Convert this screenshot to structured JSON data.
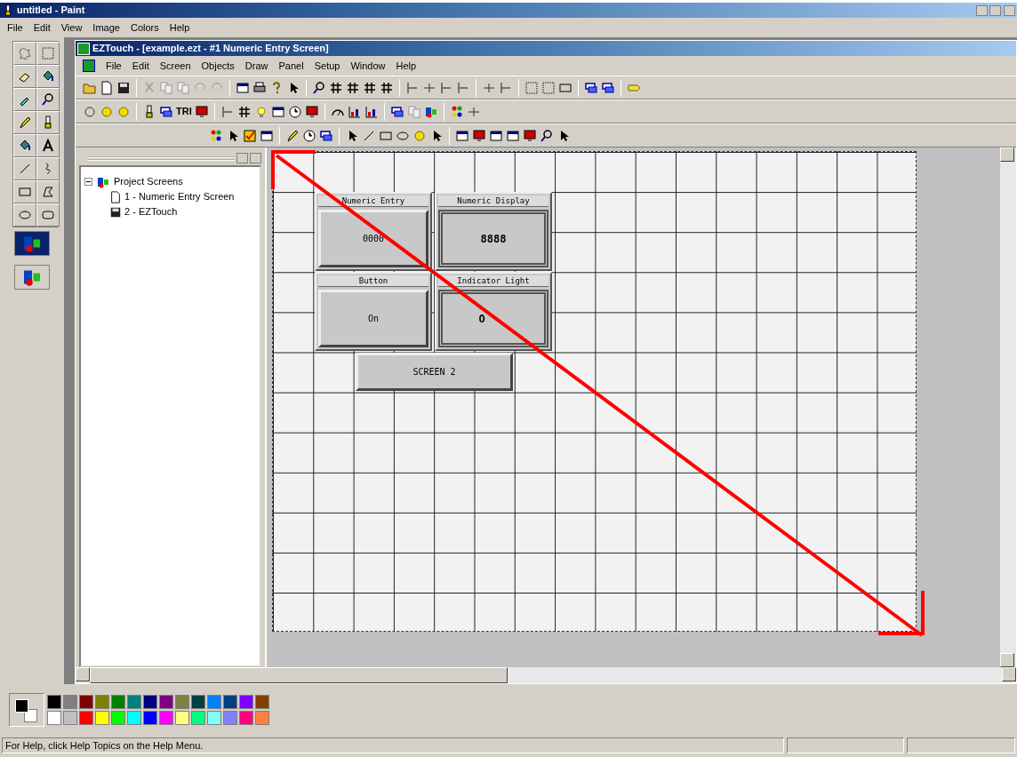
{
  "paint": {
    "title": "untitled - Paint",
    "menu": [
      "File",
      "Edit",
      "View",
      "Image",
      "Colors",
      "Help"
    ],
    "foreground": {
      "color": "#000000"
    },
    "background": {
      "color": "#ffffff"
    },
    "palette": [
      {
        "color": "#000000"
      },
      {
        "color": "#808080"
      },
      {
        "color": "#800000"
      },
      {
        "color": "#808000"
      },
      {
        "color": "#008000"
      },
      {
        "color": "#008080"
      },
      {
        "color": "#000080"
      },
      {
        "color": "#800080"
      },
      {
        "color": "#808040"
      },
      {
        "color": "#004040"
      },
      {
        "color": "#0080ff"
      },
      {
        "color": "#004080"
      },
      {
        "color": "#8000ff"
      },
      {
        "color": "#804000"
      },
      {
        "color": "#ffffff"
      },
      {
        "color": "#c0c0c0"
      },
      {
        "color": "#ff0000"
      },
      {
        "color": "#ffff00"
      },
      {
        "color": "#00ff00"
      },
      {
        "color": "#00ffff"
      },
      {
        "color": "#0000ff"
      },
      {
        "color": "#ff00ff"
      },
      {
        "color": "#ffff80"
      },
      {
        "color": "#00ff80"
      },
      {
        "color": "#80ffff"
      },
      {
        "color": "#8080ff"
      },
      {
        "color": "#ff0080"
      },
      {
        "color": "#ff8040"
      }
    ],
    "status": "For Help, click Help Topics on the Help Menu."
  },
  "eztouch": {
    "title": "EZTouch - [example.ezt - #1 Numeric Entry Screen]",
    "menu": [
      "File",
      "Edit",
      "Screen",
      "Objects",
      "Draw",
      "Panel",
      "Setup",
      "Window",
      "Help"
    ],
    "toolbar_label": "TRI",
    "tree": {
      "label": "Project Screens",
      "expanded": true,
      "children": [
        {
          "label": "1 - Numeric Entry Screen"
        },
        {
          "label": "2 - EZTouch"
        }
      ]
    },
    "objects": [
      {
        "kind": "entry",
        "label": "Numeric Entry",
        "value": "0000"
      },
      {
        "kind": "display",
        "label": "Numeric Display",
        "value": "8888"
      },
      {
        "kind": "entry",
        "label": "Button",
        "value": "On"
      },
      {
        "kind": "display",
        "label": "Indicator Light",
        "value": "O"
      }
    ],
    "screen_button": "SCREEN 2"
  }
}
